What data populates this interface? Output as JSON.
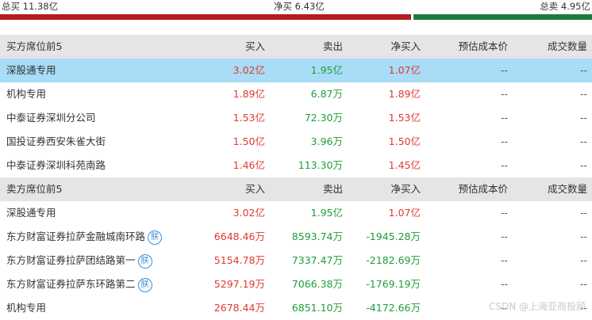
{
  "summary": {
    "buy_total": "总买 11.38亿",
    "net_buy": "净买 6.43亿",
    "sell_total": "总卖 4.95亿"
  },
  "buy_section": {
    "header": {
      "title": "买方席位前5",
      "col_buy": "买入",
      "col_sell": "卖出",
      "col_net": "净买入",
      "col_cost": "预估成本价",
      "col_qty": "成交数量"
    },
    "rows": [
      {
        "name": "深股通专用",
        "buy": "3.02亿",
        "sell": "1.95亿",
        "net": "1.07亿",
        "cost": "--",
        "qty": "--"
      },
      {
        "name": "机构专用",
        "buy": "1.89亿",
        "sell": "6.87万",
        "net": "1.89亿",
        "cost": "--",
        "qty": "--"
      },
      {
        "name": "中泰证券深圳分公司",
        "buy": "1.53亿",
        "sell": "72.30万",
        "net": "1.53亿",
        "cost": "--",
        "qty": "--"
      },
      {
        "name": "国投证券西安朱雀大街",
        "buy": "1.50亿",
        "sell": "3.96万",
        "net": "1.50亿",
        "cost": "--",
        "qty": "--"
      },
      {
        "name": "中泰证券深圳科苑南路",
        "buy": "1.46亿",
        "sell": "113.30万",
        "net": "1.45亿",
        "cost": "--",
        "qty": "--"
      }
    ]
  },
  "sell_section": {
    "header": {
      "title": "卖方席位前5",
      "col_buy": "买入",
      "col_sell": "卖出",
      "col_net": "净买入",
      "col_cost": "预估成本价",
      "col_qty": "成交数量"
    },
    "rows": [
      {
        "name": "深股通专用",
        "buy": "3.02亿",
        "sell": "1.95亿",
        "net": "1.07亿",
        "cost": "--",
        "qty": "--"
      },
      {
        "name": "东方财富证券拉萨金融城南环路",
        "badge": "朕",
        "buy": "6648.46万",
        "sell": "8593.74万",
        "net": "-1945.28万",
        "cost": "--",
        "qty": "--"
      },
      {
        "name": "东方财富证券拉萨团结路第一",
        "badge": "朕",
        "buy": "5154.78万",
        "sell": "7337.47万",
        "net": "-2182.69万",
        "cost": "--",
        "qty": "--"
      },
      {
        "name": "东方财富证券拉萨东环路第二",
        "badge": "朕",
        "buy": "5297.19万",
        "sell": "7066.38万",
        "net": "-1769.19万",
        "cost": "--",
        "qty": "--"
      },
      {
        "name": "机构专用",
        "buy": "2678.44万",
        "sell": "6851.10万",
        "net": "-4172.66万",
        "cost": "--",
        "qty": "--"
      }
    ]
  },
  "watermark": "CSDN @上海亚商投顾"
}
